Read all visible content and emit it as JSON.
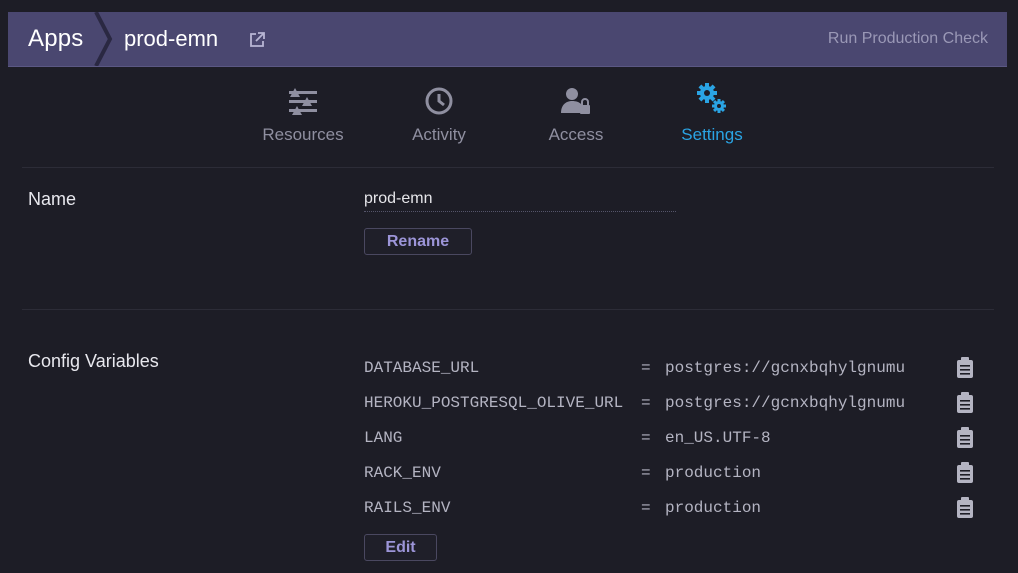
{
  "header": {
    "apps_label": "Apps",
    "app_name": "prod-emn",
    "run_check_label": "Run Production Check"
  },
  "tabs": [
    {
      "label": "Resources",
      "icon": "resources-icon",
      "active": false
    },
    {
      "label": "Activity",
      "icon": "clock-icon",
      "active": false
    },
    {
      "label": "Access",
      "icon": "user-lock-icon",
      "active": false
    },
    {
      "label": "Settings",
      "icon": "gears-icon",
      "active": true
    }
  ],
  "name_section": {
    "label": "Name",
    "value": "prod-emn",
    "rename_label": "Rename"
  },
  "config_section": {
    "label": "Config Variables",
    "vars": [
      {
        "key": "DATABASE_URL",
        "value": "postgres://gcnxbqhylgnumu"
      },
      {
        "key": "HEROKU_POSTGRESQL_OLIVE_URL",
        "value": "postgres://gcnxbqhylgnumu"
      },
      {
        "key": "LANG",
        "value": "en_US.UTF-8"
      },
      {
        "key": "RACK_ENV",
        "value": "production"
      },
      {
        "key": "RAILS_ENV",
        "value": "production"
      }
    ],
    "eq": "=",
    "edit_label": "Edit"
  },
  "colors": {
    "header_bg": "#4a4770",
    "page_bg": "#1d1d26",
    "active_tab": "#2aa4e4",
    "button_text": "#9c95d8"
  }
}
